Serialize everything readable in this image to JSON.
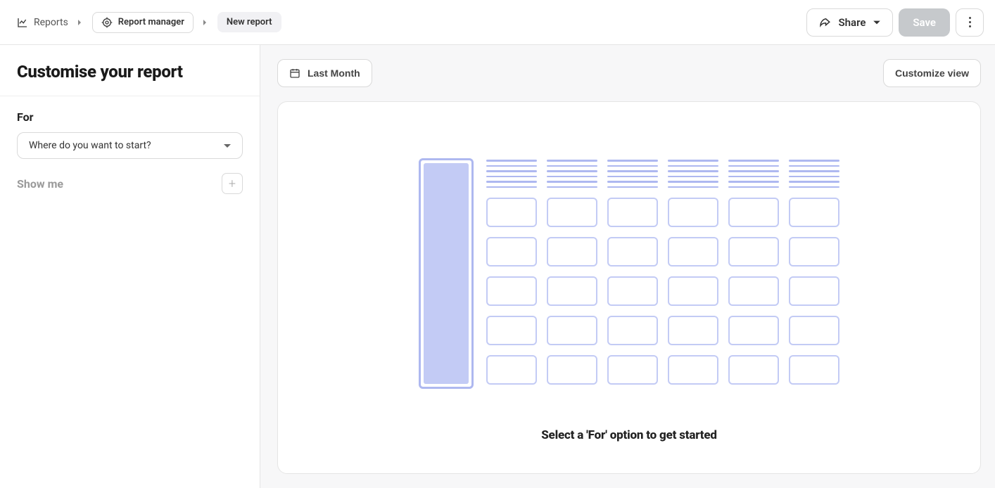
{
  "breadcrumb": {
    "root_label": "Reports",
    "manager_label": "Report manager",
    "current_label": "New report"
  },
  "header": {
    "share_label": "Share",
    "save_label": "Save"
  },
  "sidebar": {
    "title": "Customise your report",
    "for_label": "For",
    "for_dropdown_placeholder": "Where do you want to start?",
    "show_me_label": "Show me"
  },
  "content": {
    "date_range_label": "Last Month",
    "customize_view_label": "Customize view",
    "empty_state_text": "Select a 'For' option to get started"
  }
}
